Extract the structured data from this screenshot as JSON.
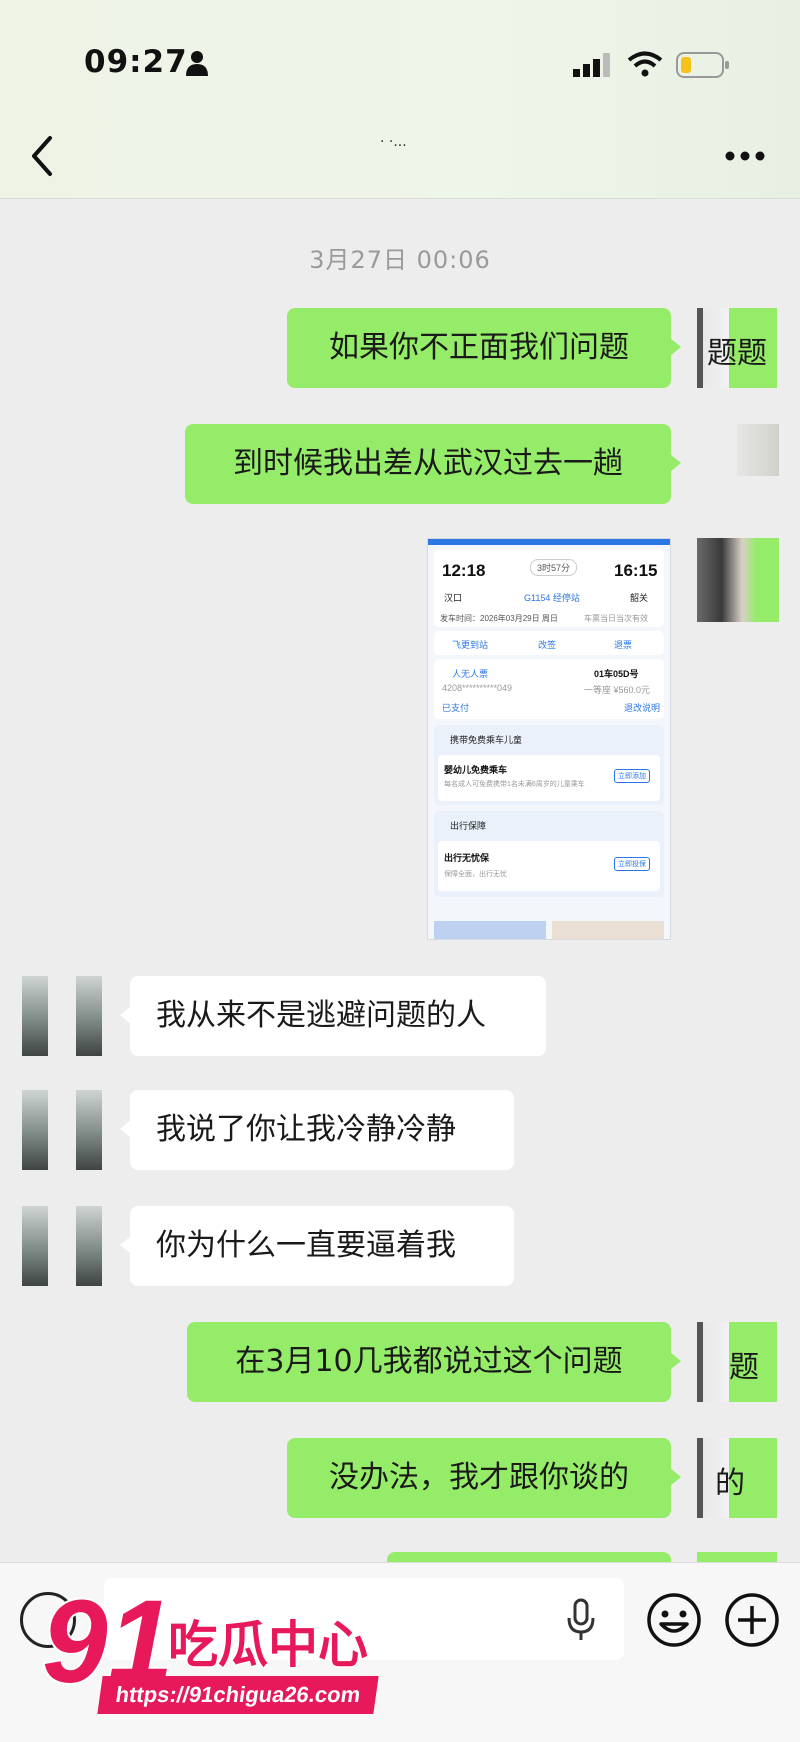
{
  "status_bar": {
    "time": "09:27"
  },
  "header": {
    "title": "· ·..."
  },
  "timestamp": "3月27日 00:06",
  "messages": [
    {
      "text": "如果你不正面我们问题",
      "avatar_fragment": "题题"
    },
    {
      "text": "到时候我出差从武汉过去一趟",
      "avatar_fragment": ""
    },
    {
      "text": "我从来不是逃避问题的人"
    },
    {
      "text": "我说了你让我冷静冷静"
    },
    {
      "text": "你为什么一直要逼着我"
    },
    {
      "text": "在3月10几我都说过这个问题",
      "avatar_fragment": "题"
    },
    {
      "text": "没办法，我才跟你谈的",
      "avatar_fragment": "的"
    }
  ],
  "ticket": {
    "depart_time": "12:18",
    "duration": "3时57分",
    "arrive_time": "16:15",
    "from": "汉口",
    "train": "G1154 经停站",
    "to": "韶关",
    "date_line": "发车时间：2026年03月29日 周日",
    "date_note": "车票当日当次有效",
    "actions": [
      "飞更到站",
      "改签",
      "退票"
    ],
    "passenger": "人无人票",
    "seat": "01车05D号",
    "id_mask": "4208**********049",
    "seat_class": "一等座 ¥560.0元",
    "paid": "已支付",
    "ticket_note": "退改说明",
    "child_section": "携带免费乘车儿童",
    "child_title": "婴幼儿免费乘车",
    "child_desc": "每名成人可免费携带1名未满6周岁的儿童乘车",
    "child_btn": "立即添加",
    "insurance_section": "出行保障",
    "insurance_title": "出行无忧保",
    "insurance_desc": "保障全面，出行无忧",
    "insurance_btn": "立即投保"
  },
  "watermark": {
    "logo": "91",
    "name": "吃瓜中心",
    "url": "https://91chigua26.com"
  },
  "colors": {
    "outgoing_bubble": "#95ec69",
    "incoming_bubble": "#ffffff",
    "chat_bg": "#ededed",
    "watermark": "#e8195a"
  },
  "icons": [
    "person-icon",
    "signal-icon",
    "wifi-icon",
    "battery-icon",
    "back-icon",
    "more-icon",
    "voice-icon",
    "mic-icon",
    "emoji-icon",
    "plus-icon"
  ]
}
